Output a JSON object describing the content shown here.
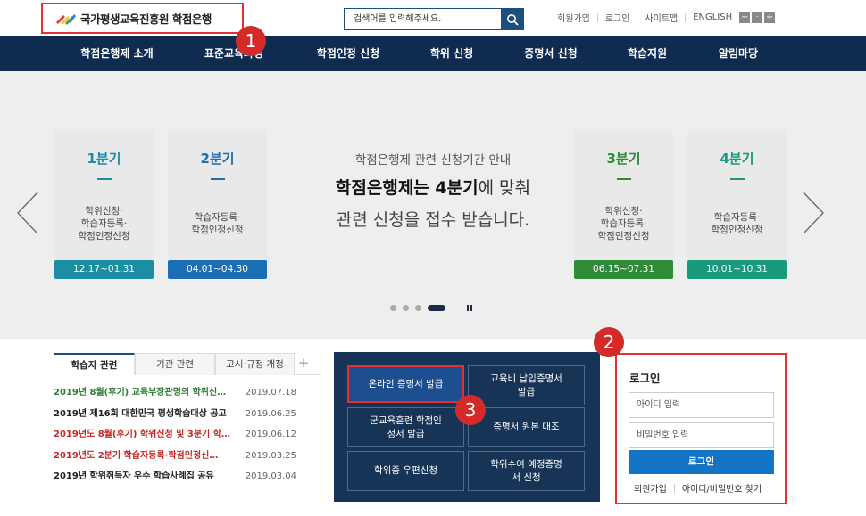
{
  "header": {
    "logo_text": "국가평생교육진흥원  학점은행",
    "search_placeholder": "검색어를 입력해주세요.",
    "util_links": [
      "회원가입",
      "로그인",
      "사이트맵",
      "ENGLISH"
    ],
    "zoom_buttons": [
      "−",
      "·",
      "+"
    ]
  },
  "nav": {
    "items": [
      "학점은행제 소개",
      "표준교육과정",
      "학점인정 신청",
      "학위 신청",
      "증명서 신청",
      "학습지원",
      "알림마당"
    ]
  },
  "slider": {
    "quarters": [
      {
        "title": "1분기",
        "desc": [
          "학위신청·",
          "학습자등록·",
          "학점인정신청"
        ],
        "period": "12.17~01.31",
        "color": "#1a8fa3"
      },
      {
        "title": "2분기",
        "desc": [
          "학습자등록·",
          "학점인정신청"
        ],
        "period": "04.01~04.30",
        "color": "#1d6fb3"
      },
      {
        "title": "3분기",
        "desc": [
          "학위신청·",
          "학습자등록·",
          "학점인정신청"
        ],
        "period": "06.15~07.31",
        "color": "#2e8b38"
      },
      {
        "title": "4분기",
        "desc": [
          "학습자등록·",
          "학점인정신청"
        ],
        "period": "10.01~10.31",
        "color": "#1a9a7c"
      }
    ],
    "center": {
      "subtitle": "학점은행제 관련 신청기간 안내",
      "line1_bold": "학점은행제는 4분기",
      "line1_rest": "에 맞춰",
      "line2": "관련 신청을 접수 받습니다."
    },
    "pagination": {
      "count": 4,
      "active_index": 3
    }
  },
  "notices": {
    "tabs": [
      "학습자 관련",
      "기관 관련",
      "고시·규정 개정"
    ],
    "plus": "+",
    "items": [
      {
        "title": "2019년 8월(후기) 교육부장관명의 학위신…",
        "date": "2019.07.18",
        "color": "#2e7d32"
      },
      {
        "title": "2019년 제16회 대한민국 평생학습대상 공고",
        "date": "2019.06.25",
        "color": "#222222"
      },
      {
        "title": "2019년도 8월(후기) 학위신청 및 3분기 학…",
        "date": "2019.06.12",
        "color": "#c62828"
      },
      {
        "title": "2019년도 2분기 학습자등록·학점인정신…",
        "date": "2019.03.25",
        "color": "#c62828"
      },
      {
        "title": "2019년 학위취득자 우수 학습사례집 공유",
        "date": "2019.03.04",
        "color": "#222222"
      }
    ]
  },
  "cert": {
    "buttons": [
      "온라인 증명서 발급",
      "교육비 납입증명서 발급",
      "군교육훈련 학점인정서 발급",
      "증명서 원본 대조",
      "학위증 우편신청",
      "학위수여 예정증명서 신청"
    ]
  },
  "login": {
    "title": "로그인",
    "id_placeholder": "아이디 입력",
    "pw_placeholder": "비밀번호 입력",
    "button": "로그인",
    "links": [
      "회원가입",
      "아이디/비밀번호 찾기"
    ]
  },
  "badges": [
    "1",
    "2",
    "3"
  ]
}
